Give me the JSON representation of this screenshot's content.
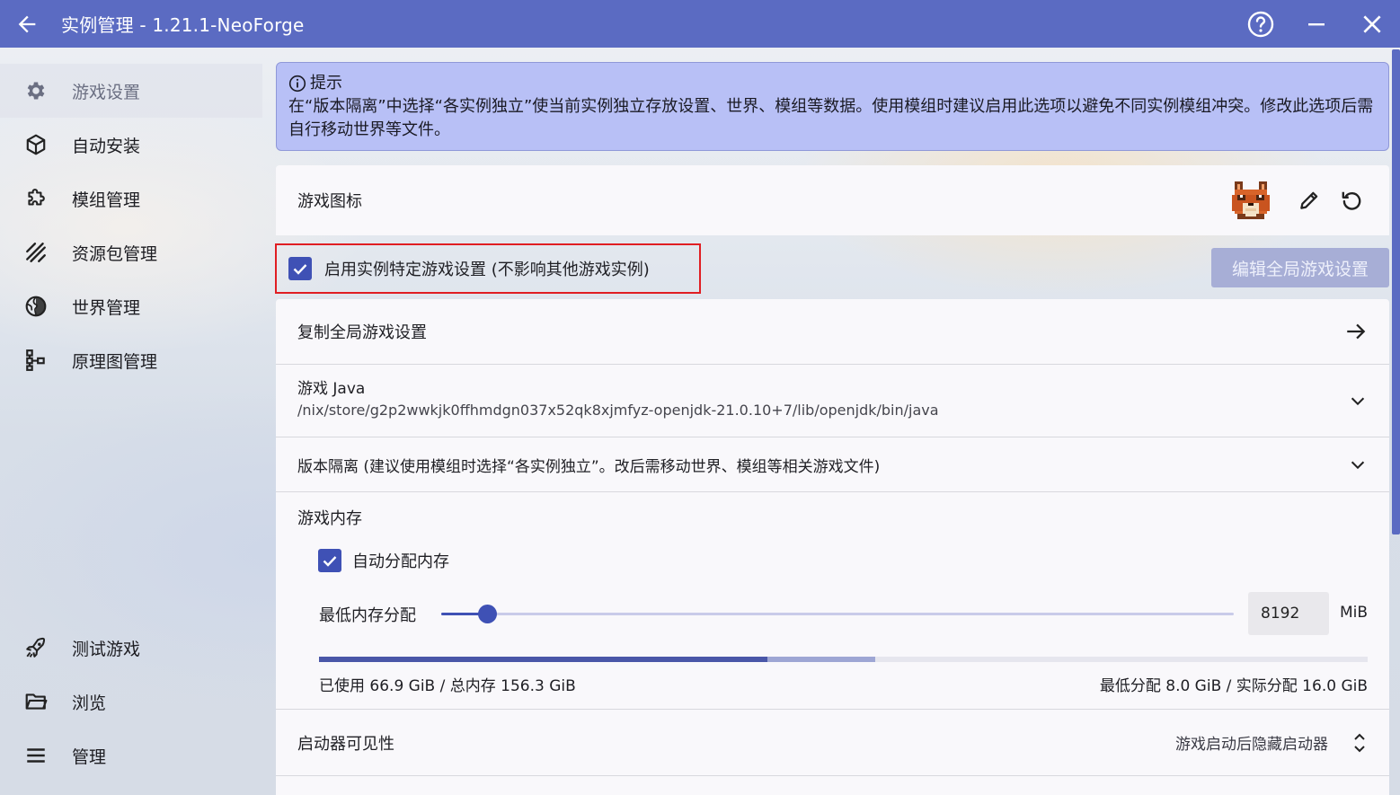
{
  "window": {
    "title": "实例管理 - 1.21.1-NeoForge"
  },
  "sidebar": {
    "items": [
      {
        "label": "游戏设置",
        "icon": "gear-icon",
        "active": true
      },
      {
        "label": "自动安装",
        "icon": "cube-icon"
      },
      {
        "label": "模组管理",
        "icon": "puzzle-icon"
      },
      {
        "label": "资源包管理",
        "icon": "texture-icon"
      },
      {
        "label": "世界管理",
        "icon": "globe-icon"
      },
      {
        "label": "原理图管理",
        "icon": "schematic-icon"
      }
    ],
    "bottom_items": [
      {
        "label": "测试游戏",
        "icon": "rocket-icon"
      },
      {
        "label": "浏览",
        "icon": "folder-icon"
      },
      {
        "label": "管理",
        "icon": "menu-icon"
      }
    ]
  },
  "hint": {
    "title": "提示",
    "text": "在“版本隔离”中选择“各实例独立”使当前实例独立存放设置、世界、模组等数据。使用模组时建议启用此选项以避免不同实例模组冲突。修改此选项后需自行移动世界等文件。"
  },
  "game_icon": {
    "label": "游戏图标"
  },
  "enable_specific": {
    "label": "启用实例特定游戏设置 (不影响其他游戏实例)",
    "checked": true
  },
  "edit_global_button": "编辑全局游戏设置",
  "copy_global": {
    "label": "复制全局游戏设置"
  },
  "java": {
    "label": "游戏 Java",
    "path": "/nix/store/g2p2wwkjk0ffhmdgn037x52qk8xjmfyz-openjdk-21.0.10+7/lib/openjdk/bin/java"
  },
  "isolation": {
    "label": "版本隔离 (建议使用模组时选择“各实例独立”。改后需移动世界、模组等相关游戏文件)"
  },
  "memory": {
    "title": "游戏内存",
    "auto_label": "自动分配内存",
    "auto_checked": true,
    "min_label": "最低内存分配",
    "min_value": "8192",
    "unit": "MiB",
    "used_fraction": 0.428,
    "alloc_fraction": 0.53,
    "usage_text": "已使用 66.9 GiB / 总内存 156.3 GiB",
    "alloc_text": "最低分配 8.0 GiB / 实际分配 16.0 GiB"
  },
  "launcher_visibility": {
    "label": "启动器可见性",
    "value": "游戏启动后隐藏启动器"
  },
  "colors": {
    "primary": "#5b6bc2",
    "accent": "#3f51b5",
    "hint_bg": "#b8c0f6",
    "highlight_border": "#e01e23"
  }
}
